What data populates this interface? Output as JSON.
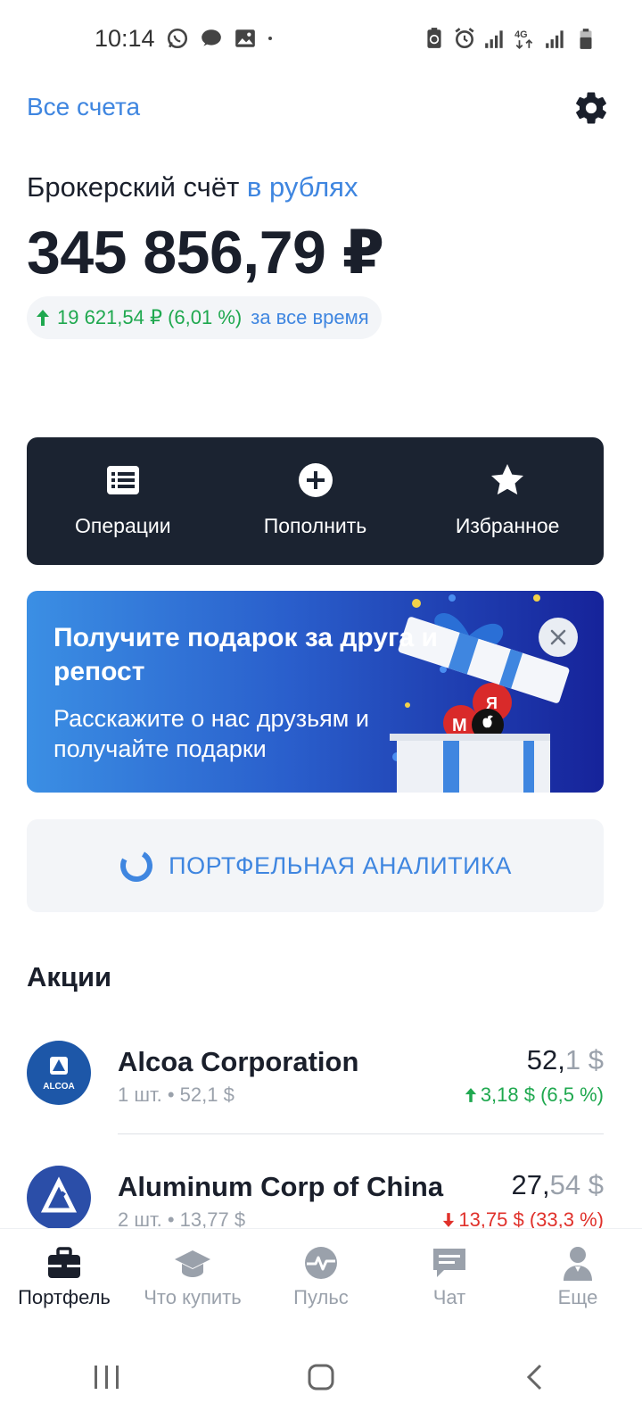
{
  "status_bar": {
    "time": "10:14",
    "left_icons": [
      "whatsapp-icon",
      "message-icon",
      "gallery-icon",
      "dot-icon"
    ],
    "right_icons": [
      "battery-saver-icon",
      "alarm-icon",
      "signal-icon",
      "4g-icon",
      "signal-icon",
      "battery-icon"
    ]
  },
  "header": {
    "all_accounts": "Все счета",
    "settings_icon": "gear-icon"
  },
  "account": {
    "title": "Брокерский счёт",
    "currency": "в рублях",
    "balance": "345 856,79 ₽",
    "change": "19 621,54 ₽ (6,01 %)",
    "period": "за все время"
  },
  "actions": [
    {
      "label": "Операции",
      "icon": "list-icon"
    },
    {
      "label": "Пополнить",
      "icon": "plus-circle-icon"
    },
    {
      "label": "Избранное",
      "icon": "star-icon"
    }
  ],
  "promo": {
    "title": "Получите подарок за друга и репост",
    "text": "Расскажите о нас друзьям и получайте подарки"
  },
  "analytics": {
    "label": "ПОРТФЕЛЬНАЯ АНАЛИТИКА"
  },
  "stocks": {
    "title": "Акции",
    "items": [
      {
        "name": "Alcoa Corporation",
        "logo_text": "ALCOA",
        "qty": "1 шт. • 52,1 $",
        "price_int": "52,",
        "price_dec": "1 $",
        "change": "3,18 $ (6,5 %)",
        "direction": "up"
      },
      {
        "name": "Aluminum Corp of China",
        "qty": "2 шт. • 13,77 $",
        "price_int": "27,",
        "price_dec": "54 $",
        "change": "13,75 $ (33,3 %)",
        "direction": "down"
      }
    ]
  },
  "bottom_nav": [
    {
      "label": "Портфель",
      "icon": "briefcase-icon",
      "active": true
    },
    {
      "label": "Что купить",
      "icon": "graduation-cap-icon",
      "active": false
    },
    {
      "label": "Пульс",
      "icon": "pulse-icon",
      "active": false
    },
    {
      "label": "Чат",
      "icon": "chat-icon",
      "active": false
    },
    {
      "label": "Еще",
      "icon": "user-icon",
      "active": false
    }
  ],
  "colors": {
    "accent": "#3f86e0",
    "positive": "#1fa84f",
    "negative": "#e0312b",
    "dark_panel": "#1b2331"
  }
}
